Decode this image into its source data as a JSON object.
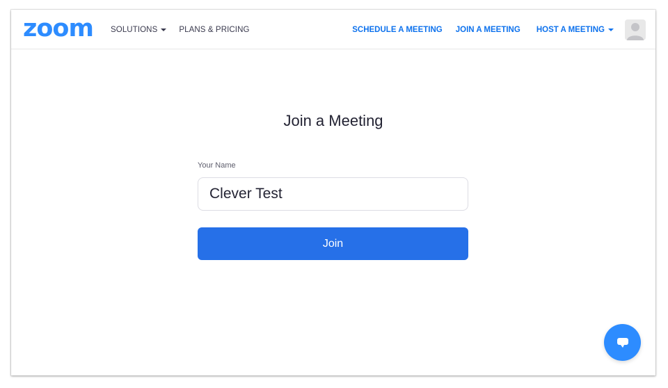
{
  "nav": {
    "logo": "zoom",
    "solutions": "SOLUTIONS",
    "plans": "PLANS & PRICING",
    "schedule": "SCHEDULE A MEETING",
    "join": "JOIN A MEETING",
    "host": "HOST A MEETING"
  },
  "main": {
    "title": "Join a Meeting",
    "name_label": "Your Name",
    "name_value": "Clever Test",
    "join_label": "Join"
  },
  "icons": {
    "avatar": "user-avatar-icon",
    "chat": "chat-bubble-icon",
    "caret": "caret-down-icon"
  },
  "colors": {
    "brand": "#2d8cff",
    "link": "#0e72ed",
    "join_button": "#2670e8"
  }
}
